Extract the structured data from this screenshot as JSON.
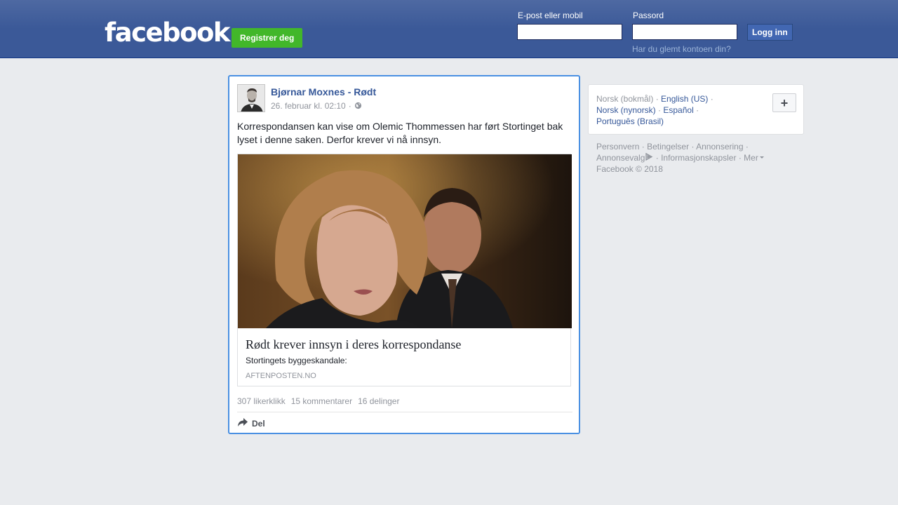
{
  "header": {
    "logo": "facebook",
    "register_label": "Registrer deg",
    "email_label": "E-post eller mobil",
    "email_value": "",
    "password_label": "Passord",
    "password_value": "",
    "login_label": "Logg inn",
    "forgot_label": "Har du glemt kontoen din?"
  },
  "post": {
    "author": "Bjørnar Moxnes - Rødt",
    "timestamp": "26. februar kl. 02:10",
    "meta_separator": "·",
    "privacy_icon": "globe-icon",
    "text": "Korrespondansen kan vise om Olemic Thommessen har ført Stortinget bak lyset i denne saken. Derfor krever vi nå innsyn.",
    "link": {
      "title": "Rødt krever innsyn i deres korrespondanse",
      "description": "Stortingets byggeskandale:",
      "domain": "AFTENPOSTEN.NO"
    },
    "likes": "307 likerklikk",
    "comments": "15 kommentarer",
    "shares": "16 delinger",
    "share_label": "Del",
    "share_icon": "share-arrow-icon"
  },
  "languages": {
    "current": "Norsk (bokmål)",
    "options": [
      "English (US)",
      "Norsk (nynorsk)",
      "Español",
      "Português (Brasil)"
    ],
    "add_icon": "plus-icon"
  },
  "footer": {
    "links": [
      "Personvern",
      "Betingelser",
      "Annonsering",
      "Annonsevalg",
      "Informasjonskapsler",
      "Mer"
    ],
    "copyright": "Facebook © 2018"
  },
  "colors": {
    "brand": "#3b5998",
    "register": "#42b72a",
    "link": "#365899",
    "focus_border": "#4a90e2",
    "background": "#e9ebee"
  }
}
